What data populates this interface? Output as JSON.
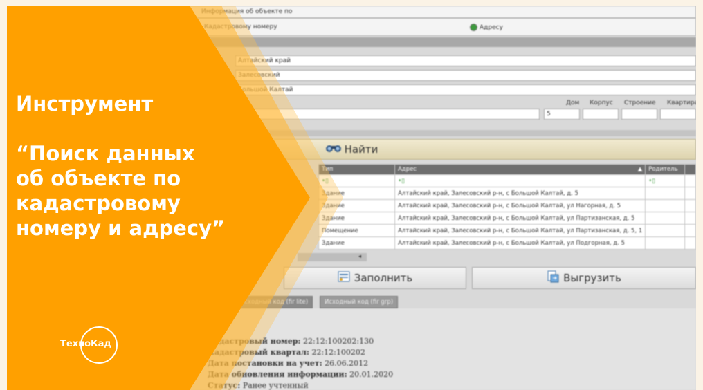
{
  "header": {
    "info_label": "Информация об объекте по",
    "by_cadastral": "Кадастровому номеру",
    "by_address": "Адресу"
  },
  "address": {
    "region": "Алтайский край",
    "district": "Залесовский",
    "locality": "Большой Калтай",
    "house_label": "Дом",
    "house_value": "5",
    "corpus_label": "Корпус",
    "building_label": "Строение",
    "flat_label": "Квартира"
  },
  "find_button": "Найти",
  "results": {
    "columns": [
      "Тип",
      "Адрес",
      "Родитель"
    ],
    "rows": [
      {
        "type": "Здание",
        "address": "Алтайский край, Залесовский р-н, с Большой Калтай, д. 5"
      },
      {
        "type": "Здание",
        "address": "Алтайский край, Залесовский р-н, с Большой Калтай, ул Нагорная, д. 5"
      },
      {
        "type": "Здание",
        "address": "Алтайский край, Залесовский р-н, с Большой Калтай, ул Партизанская, д. 5"
      },
      {
        "type": "Помещение",
        "address": "Алтайский край, Залесовский р-н, с Большой Калтай, ул Партизанская, д. 5, 1"
      },
      {
        "type": "Здание",
        "address": "Алтайский край, Залесовский р-н, с Большой Калтай, ул Подгорная, д. 5"
      }
    ]
  },
  "buttons": {
    "fill": "Заполнить",
    "export": "Выгрузить"
  },
  "tabs": [
    "Исходный код (fir lite)",
    "Исходный код (fir grp)"
  ],
  "report": {
    "cad_number_label": "Кадастровый номер:",
    "cad_number_value": "22:12:100202:130",
    "cad_quarter_label": "Кадастровый квартал:",
    "cad_quarter_value": "22:12:100202",
    "reg_date_label": "Дата постановки на учет:",
    "reg_date_value": "26.06.2012",
    "update_label": "Дата обновления информации:",
    "update_value": "20.01.2020",
    "status_label": "Статус:",
    "status_value": "Ранее учтенный"
  },
  "overlay": {
    "line1": "Инструмент",
    "line2": "“Поиск данных",
    "line3": "об объекте по",
    "line4": "кадастровому",
    "line5": "номеру и адресу”",
    "logo": "ТехноКад"
  },
  "colors": {
    "orange": "#ffa000",
    "orange_light": "#ffc14d",
    "find_bar": "#e8dfc0"
  }
}
